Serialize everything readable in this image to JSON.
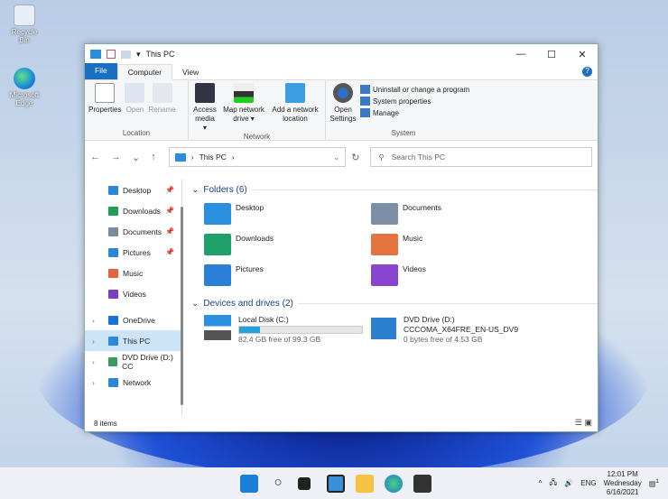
{
  "desktop": {
    "icons": [
      {
        "label": "Recycle Bin"
      },
      {
        "label": "Microsoft Edge"
      }
    ]
  },
  "window": {
    "title": "This PC",
    "controls": {
      "minimize": "—",
      "maximize": "☐",
      "close": "✕"
    }
  },
  "tabs": [
    {
      "label": "File"
    },
    {
      "label": "Computer"
    },
    {
      "label": "View"
    }
  ],
  "ribbon": {
    "location": {
      "label": "Location",
      "buttons": [
        {
          "label": "Properties"
        },
        {
          "label": "Open"
        },
        {
          "label": "Rename"
        }
      ]
    },
    "network": {
      "label": "Network",
      "buttons": [
        {
          "label": "Access media ▾"
        },
        {
          "label": "Map network drive ▾"
        },
        {
          "label": "Add a network location"
        }
      ]
    },
    "system": {
      "label": "System",
      "open_settings": "Open Settings",
      "items": [
        {
          "label": "Uninstall or change a program"
        },
        {
          "label": "System properties"
        },
        {
          "label": "Manage"
        }
      ]
    }
  },
  "nav": {
    "back": "←",
    "forward": "→",
    "up_list": "⌄",
    "up": "↑",
    "address": "This PC",
    "refresh": "↻",
    "search_placeholder": "Search This PC"
  },
  "sidebar": [
    {
      "label": "Desktop",
      "color": "#2b88d8"
    },
    {
      "label": "Downloads",
      "color": "#1f9d55"
    },
    {
      "label": "Documents",
      "color": "#7a8ba0"
    },
    {
      "label": "Pictures",
      "color": "#2b88d8"
    },
    {
      "label": "Music",
      "color": "#e0663a"
    },
    {
      "label": "Videos",
      "color": "#7b3fc4"
    },
    {
      "label": "OneDrive",
      "color": "#1a73d0"
    },
    {
      "label": "This PC",
      "color": "#2b88d8"
    },
    {
      "label": "DVD Drive (D:) CC",
      "color": "#3a9a5a"
    },
    {
      "label": "Network",
      "color": "#2b88d8"
    }
  ],
  "folders": {
    "heading": "Folders (6)",
    "items": [
      {
        "label": "Desktop",
        "color": "#2b8fe0"
      },
      {
        "label": "Documents",
        "color": "#7d8fa6"
      },
      {
        "label": "Downloads",
        "color": "#1fa06a"
      },
      {
        "label": "Music",
        "color": "#e5733d"
      },
      {
        "label": "Pictures",
        "color": "#2a7fd6"
      },
      {
        "label": "Videos",
        "color": "#8a45d0"
      }
    ]
  },
  "drives": {
    "heading": "Devices and drives (2)",
    "items": [
      {
        "name": "Local Disk (C:)",
        "free": "82.4 GB free of 99.3 GB",
        "used_fraction": 0.17
      },
      {
        "name": "DVD Drive (D:)",
        "label": "CCCOMA_X64FRE_EN-US_DV9",
        "free": "0 bytes free of 4.53 GB"
      }
    ]
  },
  "status": {
    "items": "8 items"
  },
  "taskbar": {
    "tray": {
      "chevron": "^",
      "lang": "ENG",
      "time": "12:01 PM",
      "day": "Wednesday",
      "date": "6/16/2021",
      "notifications": "1"
    }
  }
}
